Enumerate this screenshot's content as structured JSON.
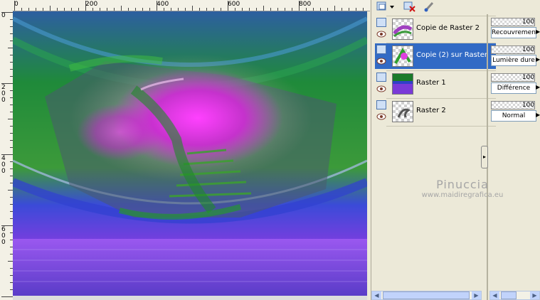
{
  "ruler": {
    "top_labels": [
      "0",
      "200",
      "400",
      "600",
      "800"
    ],
    "left_labels": [
      [
        "0"
      ],
      [
        "2",
        "0",
        "0"
      ],
      [
        "4",
        "0",
        "0"
      ],
      [
        "6",
        "0",
        "0"
      ]
    ]
  },
  "toolbar": {
    "icons": [
      "new-layer-icon",
      "dropdown-arrow-icon",
      "delete-layer-icon",
      "edit-brush-icon"
    ]
  },
  "layers": [
    {
      "name": "Copie de Raster 2",
      "opacity": "100",
      "blend": "Recouvrement",
      "selected": false
    },
    {
      "name": "Copie (2) sur Raster",
      "opacity": "100",
      "blend": "Lumière dure",
      "selected": true
    },
    {
      "name": "Raster 1",
      "opacity": "100",
      "blend": "Différence",
      "selected": false
    },
    {
      "name": "Raster 2",
      "opacity": "100",
      "blend": "Normal",
      "selected": false
    }
  ],
  "watermark": {
    "title": "Pinuccia",
    "url": "www.maidiregrafica.eu"
  },
  "colors": {
    "selection": "#316ac5",
    "panel_bg": "#ece9d8"
  }
}
